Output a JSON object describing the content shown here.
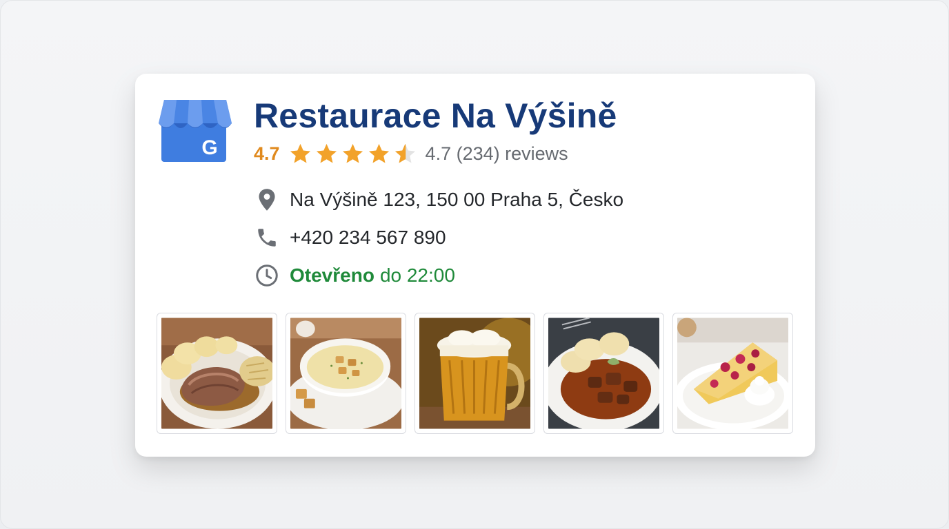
{
  "business": {
    "name": "Restaurace Na Výšině",
    "rating_value": "4.7",
    "rating": 4.7,
    "reviews_text": "4.7 (234) reviews",
    "address": "Na Výšině 123, 150 00 Praha 5, Česko",
    "phone": "+420 234 567 890",
    "hours_status": "Otevřeno",
    "hours_until": "do 22:00"
  },
  "icons": {
    "logo": "google-my-business-icon",
    "address": "location-pin-icon",
    "phone": "phone-icon",
    "hours": "clock-icon",
    "star": "star-icon"
  },
  "photos": [
    {
      "name": "photo-roast-pork-dumplings"
    },
    {
      "name": "photo-garlic-soup"
    },
    {
      "name": "photo-beer-mug"
    },
    {
      "name": "photo-goulash-dumplings"
    },
    {
      "name": "photo-fruit-cake"
    }
  ],
  "colors": {
    "title": "#173a78",
    "rating": "#e08a1e",
    "star_fill": "#f2a22a",
    "star_empty": "#e3e3e3",
    "open_green": "#1f8a3a",
    "icon_gray": "#6b6f75",
    "logo_blue": "#3f7de0"
  }
}
